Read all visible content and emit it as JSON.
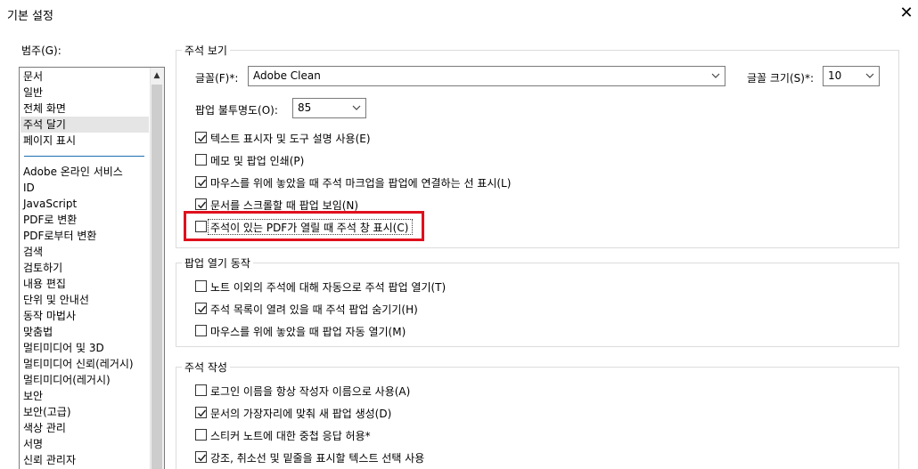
{
  "window": {
    "title": "기본 설정",
    "close_icon": "close-icon"
  },
  "categories": {
    "label": "범주(G):",
    "items": [
      {
        "label": "문서"
      },
      {
        "label": "일반"
      },
      {
        "label": "전체 화면"
      },
      {
        "label": "주석 달기",
        "selected": true
      },
      {
        "label": "페이지 표시"
      },
      {
        "label": "Adobe 온라인 서비스"
      },
      {
        "label": "ID"
      },
      {
        "label": "JavaScript"
      },
      {
        "label": "PDF로 변환"
      },
      {
        "label": "PDF로부터 변환"
      },
      {
        "label": "검색"
      },
      {
        "label": "검토하기"
      },
      {
        "label": "내용 편집"
      },
      {
        "label": "단위 및 안내선"
      },
      {
        "label": "동작 마법사"
      },
      {
        "label": "맞춤법"
      },
      {
        "label": "멀티미디어 및 3D"
      },
      {
        "label": "멀티미디어 신뢰(레거시)"
      },
      {
        "label": "멀티미디어(레거시)"
      },
      {
        "label": "보안"
      },
      {
        "label": "보안(고급)"
      },
      {
        "label": "색상 관리"
      },
      {
        "label": "서명"
      },
      {
        "label": "신뢰 관리자"
      }
    ]
  },
  "view_group": {
    "title": "주석 보기",
    "font_label": "글꼴(F)*:",
    "font_value": "Adobe Clean",
    "font_size_label": "글꼴 크기(S)*:",
    "font_size_value": "10",
    "opacity_label": "팝업 불투명도(O):",
    "opacity_value": "85",
    "options": [
      {
        "label": "텍스트 표시자 및 도구 설명 사용(E)",
        "checked": true
      },
      {
        "label": "메모 및 팝업 인쇄(P)",
        "checked": false
      },
      {
        "label": "마우스를 위에 놓았을 때 주석 마크업을 팝업에 연결하는 선 표시(L)",
        "checked": true
      },
      {
        "label": "문서를 스크롤할 때 팝업 보임(N)",
        "checked": true
      },
      {
        "label": "주석이 있는 PDF가 열릴 때 주석 창 표시(C)",
        "checked": false
      }
    ]
  },
  "popup_group": {
    "title": "팝업 열기 동작",
    "options": [
      {
        "label": "노트 이외의 주석에 대해 자동으로 주석 팝업 열기(T)",
        "checked": false
      },
      {
        "label": "주석 목록이 열려 있을 때 주석 팝업 숨기기(H)",
        "checked": true
      },
      {
        "label": "마우스를 위에 놓았을 때 팝업 자동 열기(M)",
        "checked": false
      }
    ]
  },
  "create_group": {
    "title": "주석 작성",
    "options": [
      {
        "label": "로그인 이름을 항상 작성자 이름으로 사용(A)",
        "checked": false
      },
      {
        "label": "문서의 가장자리에 맞춰 새 팝업 생성(D)",
        "checked": true
      },
      {
        "label": "스티커 노트에 대한 중첩 응답 허용*",
        "checked": false
      },
      {
        "label": "강조, 취소선 및 밑줄을 표시할 텍스트 선택 사용",
        "checked": true
      }
    ]
  },
  "colors": {
    "highlight": "#e0101d",
    "selected_bg": "#e5e5e5",
    "separator": "#1e6fb0"
  }
}
